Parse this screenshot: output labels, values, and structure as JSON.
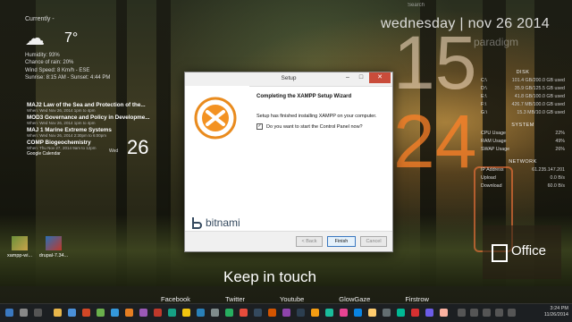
{
  "weather": {
    "currently_label": "Currently -",
    "temp": "7°",
    "icon": "cloud-rain-icon",
    "lines": [
      "Humidity: 93%",
      "Chance of rain: 20%",
      "Wind Speed: 8 Km/h - ESE",
      "Sunrise: 8:15 AM - Sunset: 4:44 PM"
    ]
  },
  "calendar": {
    "events": [
      {
        "title": "MAJ2 Law of the Sea and Protection of the...",
        "when": "When: Wed Nov 26, 2014 1pm to 4pm"
      },
      {
        "title": "MOD3 Governance and Policy in Developme...",
        "when": "When: Wed Nov 26, 2014 1pm to 4pm"
      },
      {
        "title": "MAJ 1 Marine Extreme Systems",
        "when": "When: Wed Nov 26, 2014 2:30pm to 6:00pm"
      },
      {
        "title": "COMP Biogeochemistry",
        "when": "When: Thu Nov 27, 2014 9am to 12pm"
      }
    ],
    "source": "Google Calendar",
    "day_name": "Wed",
    "day_number": "26"
  },
  "desktop_icons": [
    {
      "label": "xampp-wi..."
    },
    {
      "label": "drupal-7.34..."
    }
  ],
  "clock": {
    "search_hint": "Search",
    "date_line": "wednesday | nov 26 2014",
    "user": "paradigm",
    "hour": "15",
    "minute": "24"
  },
  "system": {
    "disk_header": "DISK",
    "disks": [
      {
        "name": "C:\\",
        "value": "101.4 GB/200.0 GB used"
      },
      {
        "name": "D:\\",
        "value": "35.9 GB/125.5 GB used"
      },
      {
        "name": "E:\\",
        "value": "41.8 GB/100.0 GB used"
      },
      {
        "name": "F:\\",
        "value": "426.7 MB/100.0 GB used"
      },
      {
        "name": "G:\\",
        "value": "15.3 MB/10.0 GB used"
      }
    ],
    "system_header": "SYSTEM",
    "usage": [
      {
        "name": "CPU Usage",
        "value": "22%"
      },
      {
        "name": "RAM Usage",
        "value": "49%"
      },
      {
        "name": "SWAP Usage",
        "value": "26%"
      }
    ],
    "network_header": "NETWORK",
    "network": [
      {
        "name": "IP Address",
        "value": "61.235.147.201"
      },
      {
        "name": "Upload",
        "value": "0.0 B/s"
      },
      {
        "name": "Download",
        "value": "60.0 B/s"
      }
    ]
  },
  "office_tile": {
    "label": "Office"
  },
  "social": {
    "heading": "Keep in touch",
    "links": [
      "Facebook",
      "Twitter",
      "Youtube",
      "GlowGaze",
      "Firstrow"
    ]
  },
  "dialog": {
    "title": "Setup",
    "heading": "Completing the XAMPP Setup Wizard",
    "body": "Setup has finished installing XAMPP on your computer.",
    "checkbox_label": "Do you want to start the Control Panel now?",
    "checkbox_checked": true,
    "brand": "bitnami",
    "back_label": "< Back",
    "finish_label": "Finish",
    "cancel_label": "Cancel"
  },
  "taskbar": {
    "time": "3:24 PM",
    "date": "11/26/2014"
  }
}
